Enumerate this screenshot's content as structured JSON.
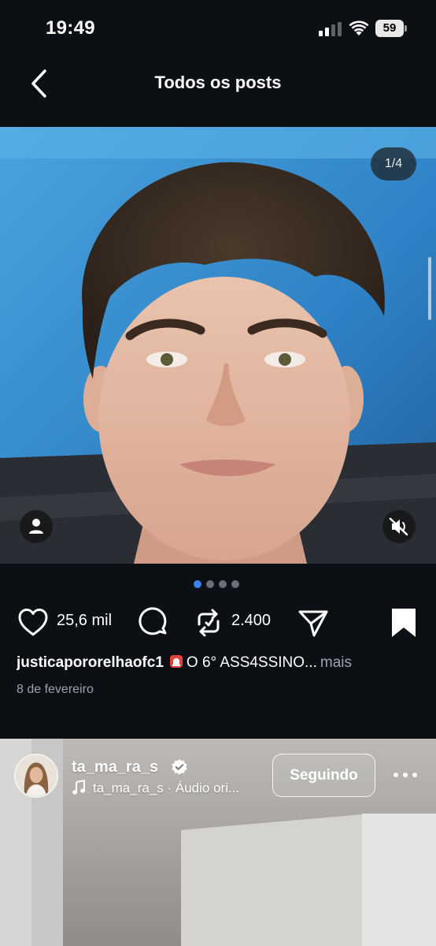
{
  "status_bar": {
    "time": "19:49",
    "battery": "59"
  },
  "nav": {
    "title": "Todos os posts",
    "back_icon": "chevron-left-icon"
  },
  "post": {
    "media_counter": "1/4",
    "carousel": {
      "total": 4,
      "active": 1
    },
    "likes": "25,6 mil",
    "reposts": "2.400",
    "saved": true,
    "caption": {
      "username": "justicapororelhaofc1",
      "emoji_icon": "siren-icon",
      "text": "O 6° ASS4SSINO...",
      "more": "mais"
    },
    "date": "8 de fevereiro"
  },
  "next_post": {
    "username": "ta_ma_ra_s",
    "verified": true,
    "audio": "ta_ma_ra_s · Áudio ori...",
    "follow_label": "Seguindo"
  },
  "colors": {
    "background": "#0c0f14",
    "active_dot": "#3b82f6",
    "inactive_dot": "#6b6f75",
    "verified": "#ffffff"
  }
}
